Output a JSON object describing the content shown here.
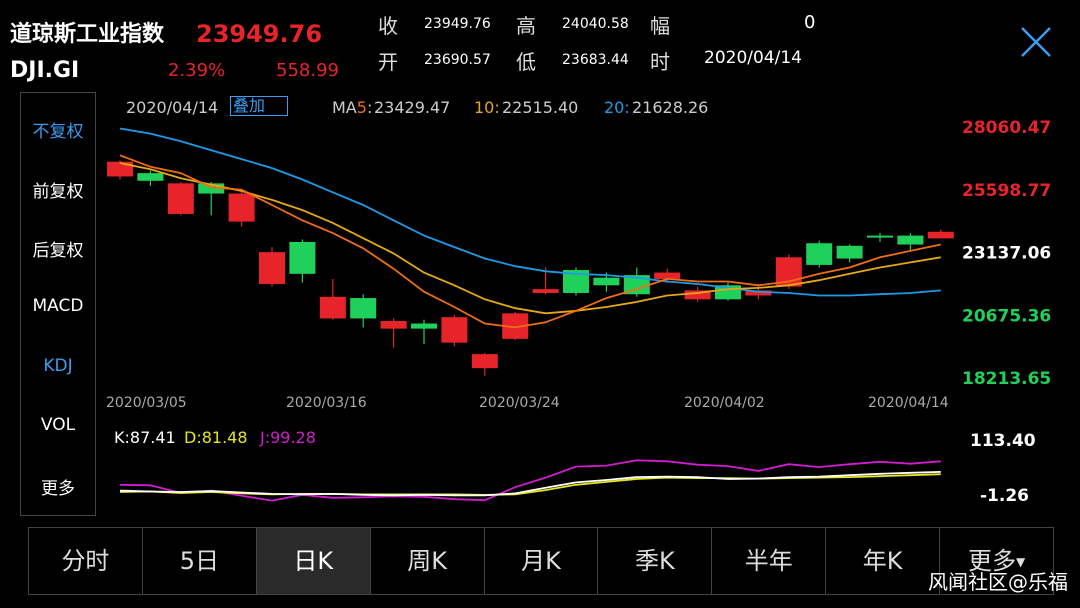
{
  "header": {
    "name": "道琼斯工业指数",
    "price": "23949.76",
    "code": "DJI.GI",
    "pct": "2.39%",
    "change": "558.99"
  },
  "quote": {
    "close_label": "收",
    "close_value": "23949.76",
    "high_label": "高",
    "high_value": "24040.58",
    "amp_label": "幅",
    "amp_value": "0",
    "open_label": "开",
    "open_value": "23690.57",
    "low_label": "低",
    "low_value": "23683.44",
    "time_label": "时",
    "time_value": "2020/04/14"
  },
  "sidebar": {
    "items": [
      {
        "label": "不复权",
        "active": true
      },
      {
        "label": "前复权",
        "active": false
      },
      {
        "label": "后复权",
        "active": false
      },
      {
        "label": "MACD",
        "active": false
      },
      {
        "label": "KDJ",
        "active": true
      },
      {
        "label": "VOL",
        "active": false
      },
      {
        "label": "更多",
        "active": false
      }
    ]
  },
  "ma_info": {
    "date": "2020/04/14",
    "stack_label": "叠加",
    "ma5_label": "MA5:",
    "ma5_value": "23429.47",
    "ma10_label": "10:",
    "ma10_value": "22515.40",
    "ma20_label": "20:",
    "ma20_value": "21628.26"
  },
  "kdj_info": {
    "k": "K:87.41",
    "d": "D:81.48",
    "j": "J:99.28"
  },
  "tabs": [
    {
      "label": "分时"
    },
    {
      "label": "5日"
    },
    {
      "label": "日K"
    },
    {
      "label": "周K"
    },
    {
      "label": "月K"
    },
    {
      "label": "季K"
    },
    {
      "label": "半年"
    },
    {
      "label": "年K"
    },
    {
      "label": "更多"
    }
  ],
  "watermark": "风闻社区@乐福",
  "colors": {
    "up": "#e8242b",
    "down": "#1fd15a",
    "ma5": "#f06d14",
    "ma10": "#e6a817",
    "ma20": "#1e9be6",
    "k": "#ffffff",
    "d": "#e6e61a",
    "j": "#d11ccf",
    "axis_red": "#e8242b",
    "axis_green": "#1fd15a"
  },
  "chart_data": [
    {
      "type": "candlestick",
      "price_axis": [
        "28060.47",
        "25598.77",
        "23137.06",
        "20675.36",
        "18213.65"
      ],
      "ylim": [
        18213.65,
        28060.47
      ],
      "x_ticks": [
        "2020/03/05",
        "2020/03/16",
        "2020/03/24",
        "2020/04/02",
        "2020/04/14"
      ],
      "candles": [
        {
          "o": 26120,
          "c": 26700,
          "h": 26750,
          "l": 26000
        },
        {
          "o": 26250,
          "c": 25950,
          "h": 26350,
          "l": 25750
        },
        {
          "o": 24650,
          "c": 25850,
          "h": 25900,
          "l": 24600
        },
        {
          "o": 25850,
          "c": 25450,
          "h": 25900,
          "l": 24600
        },
        {
          "o": 24350,
          "c": 25450,
          "h": 25500,
          "l": 24150
        },
        {
          "o": 21900,
          "c": 23150,
          "h": 23350,
          "l": 21800
        },
        {
          "o": 23550,
          "c": 22300,
          "h": 23650,
          "l": 21950
        },
        {
          "o": 20550,
          "c": 21400,
          "h": 22100,
          "l": 20500
        },
        {
          "o": 21350,
          "c": 20550,
          "h": 21500,
          "l": 20200
        },
        {
          "o": 20150,
          "c": 20450,
          "h": 20550,
          "l": 19400
        },
        {
          "o": 20350,
          "c": 20150,
          "h": 20500,
          "l": 19550
        },
        {
          "o": 19600,
          "c": 20600,
          "h": 20700,
          "l": 19450
        },
        {
          "o": 18600,
          "c": 19150,
          "h": 19200,
          "l": 18300
        },
        {
          "o": 19750,
          "c": 20750,
          "h": 20800,
          "l": 19700
        },
        {
          "o": 21550,
          "c": 21700,
          "h": 22550,
          "l": 21500
        },
        {
          "o": 22450,
          "c": 21550,
          "h": 22550,
          "l": 21450
        },
        {
          "o": 22150,
          "c": 21850,
          "h": 22350,
          "l": 21600
        },
        {
          "o": 22250,
          "c": 21500,
          "h": 22550,
          "l": 21400
        },
        {
          "o": 22100,
          "c": 22350,
          "h": 22500,
          "l": 21950
        },
        {
          "o": 21300,
          "c": 21650,
          "h": 21800,
          "l": 21200
        },
        {
          "o": 21850,
          "c": 21300,
          "h": 21950,
          "l": 21250
        },
        {
          "o": 21450,
          "c": 21650,
          "h": 21900,
          "l": 21300
        },
        {
          "o": 21800,
          "c": 22950,
          "h": 23050,
          "l": 21700
        },
        {
          "o": 23500,
          "c": 22650,
          "h": 23600,
          "l": 22550
        },
        {
          "o": 23400,
          "c": 22900,
          "h": 23450,
          "l": 22750
        },
        {
          "o": 23800,
          "c": 23750,
          "h": 23900,
          "l": 23550
        },
        {
          "o": 23800,
          "c": 23450,
          "h": 23900,
          "l": 23200
        },
        {
          "o": 23690.57,
          "c": 23949.76,
          "h": 24040.58,
          "l": 23683.44
        }
      ],
      "ma5": [
        26950,
        26500,
        26250,
        25700,
        25600,
        25000,
        24400,
        23900,
        23300,
        22500,
        21600,
        21000,
        20350,
        20200,
        20400,
        20850,
        21350,
        21700,
        22100,
        22000,
        22000,
        21850,
        22000,
        22300,
        22550,
        22950,
        23200,
        23450
      ],
      "ma10": [
        26650,
        26400,
        26050,
        25800,
        25550,
        25200,
        24800,
        24300,
        23700,
        23100,
        22350,
        21850,
        21300,
        20950,
        20750,
        20850,
        21000,
        21200,
        21450,
        21550,
        21700,
        21750,
        21850,
        22050,
        22300,
        22550,
        22750,
        22950
      ],
      "ma20": [
        28000,
        27800,
        27500,
        27150,
        26800,
        26450,
        26000,
        25500,
        25000,
        24400,
        23800,
        23350,
        22900,
        22600,
        22400,
        22300,
        22250,
        22150,
        22000,
        21900,
        21750,
        21600,
        21550,
        21450,
        21450,
        21500,
        21550,
        21650
      ]
    },
    {
      "type": "line",
      "series_names": [
        "K",
        "D",
        "J"
      ],
      "axis": [
        "113.40",
        "-1.26"
      ],
      "ylim": [
        -1.26,
        113.4
      ],
      "K": [
        8,
        6,
        5,
        7,
        4,
        1,
        0,
        1,
        -1,
        -2,
        -1,
        -2,
        -2,
        2,
        14,
        25,
        30,
        36,
        37,
        36,
        32,
        33,
        36,
        37,
        40,
        43,
        45,
        47
      ],
      "D": [
        5,
        6,
        3,
        5,
        2,
        0,
        1,
        1,
        0,
        0,
        0,
        0,
        -1,
        0,
        9,
        20,
        26,
        32,
        35,
        34,
        34,
        33,
        34,
        35,
        36,
        38,
        40,
        42
      ],
      "J": [
        20,
        19,
        3,
        8,
        -3,
        -13,
        -1,
        -7,
        -6,
        -4,
        -5,
        -10,
        -12,
        15,
        35,
        58,
        60,
        71,
        69,
        62,
        59,
        49,
        63,
        57,
        63,
        68,
        64,
        69
      ]
    }
  ]
}
